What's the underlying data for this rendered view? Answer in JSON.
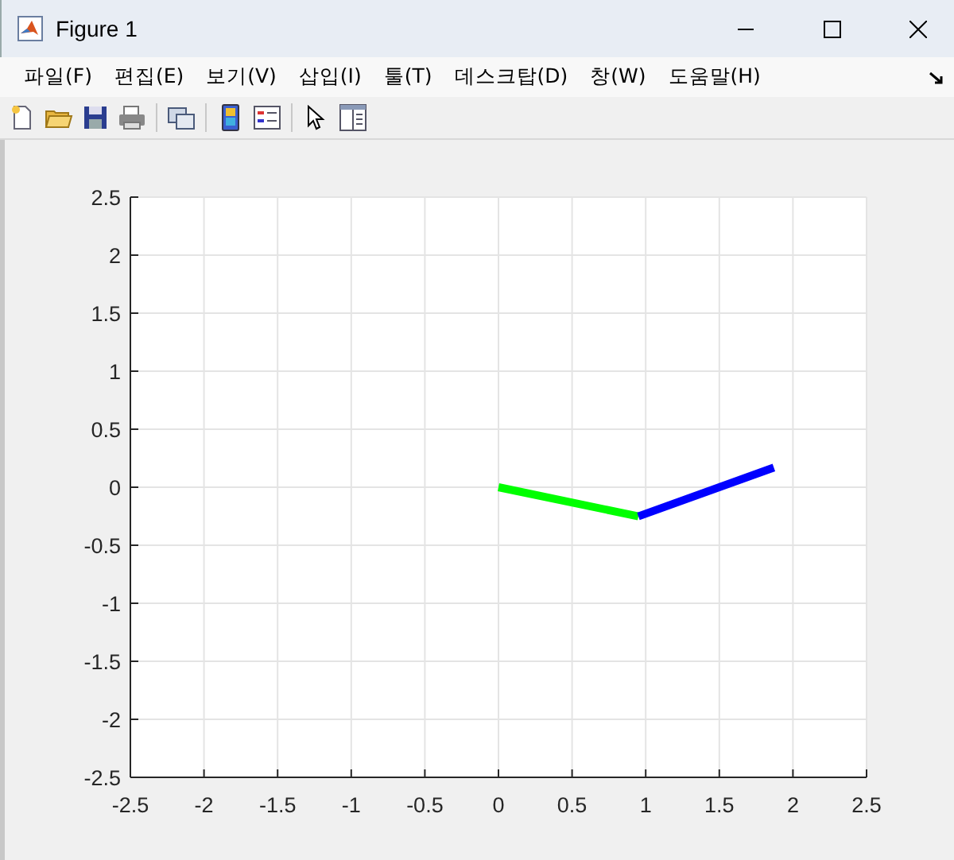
{
  "window": {
    "title": "Figure 1"
  },
  "menu": [
    "파일(F)",
    "편집(E)",
    "보기(V)",
    "삽입(I)",
    "툴(T)",
    "데스크탑(D)",
    "창(W)",
    "도움말(H)"
  ],
  "axes": {
    "chart_data": {
      "type": "line",
      "grid": true,
      "x": [
        0,
        0.95,
        1.87
      ],
      "series": [
        {
          "color": "#00ff00",
          "values": [
            0,
            -0.25,
            null
          ]
        },
        {
          "color": "#0000ff",
          "values": [
            null,
            -0.25,
            0.17
          ]
        }
      ],
      "xlim": [
        -2.5,
        2.5
      ],
      "ylim": [
        -2.5,
        2.5
      ],
      "xticks": [
        -2.5,
        -2,
        -1.5,
        -1,
        -0.5,
        0,
        0.5,
        1,
        1.5,
        2,
        2.5
      ],
      "yticks": [
        -2.5,
        -2,
        -1.5,
        -1,
        -0.5,
        0,
        0.5,
        1,
        1.5,
        2,
        2.5
      ]
    }
  }
}
